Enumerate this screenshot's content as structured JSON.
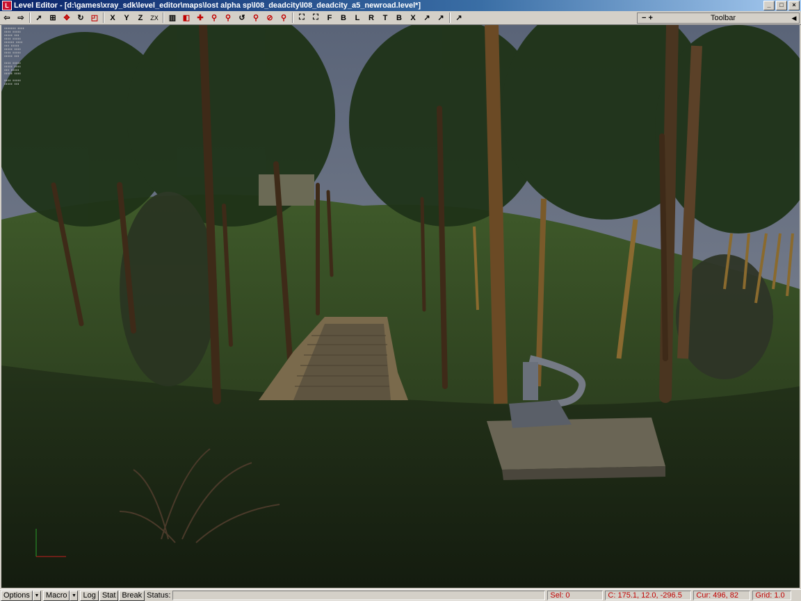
{
  "window": {
    "title": "Level Editor - [d:\\games\\xray_sdk\\level_editor\\maps\\lost alpha sp\\l08_deadcity\\l08_deadcity_a5_newroad.level*]",
    "buttons": [
      "_",
      "□",
      "×"
    ]
  },
  "toolbar": {
    "axis_y": "Y",
    "axis_z": "Z",
    "axis_zx": "ZX",
    "axis_x": "X",
    "snap_letters": [
      "F",
      "B",
      "L",
      "R",
      "T",
      "B",
      "X"
    ]
  },
  "right_panel": {
    "controls": "− +",
    "label": "Toolbar"
  },
  "statusbar": {
    "options": "Options",
    "macro": "Macro",
    "log": "Log",
    "stat": "Stat",
    "break": "Break",
    "status_label": "Status:",
    "sel": "Sel: 0",
    "coords": "C: 175.1, 12.0, -296.5",
    "cursor": "Cur: 496, 82",
    "grid": "Grid: 1.0"
  },
  "colors": {
    "title_start": "#0a246a",
    "title_end": "#a6caf0",
    "status_value": "#c00000"
  }
}
